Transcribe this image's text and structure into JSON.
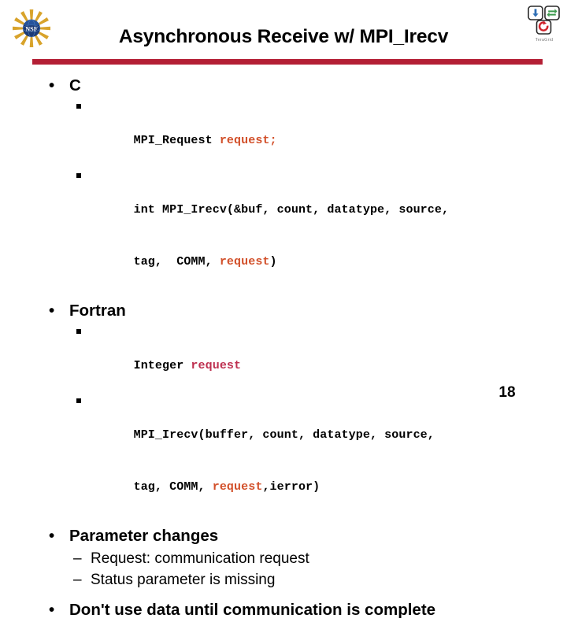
{
  "slide": {
    "title": "Asynchronous Receive w/ MPI_Irecv",
    "page_number": "18",
    "accent_color": "#B41F35",
    "highlight_orange": "#D2502A",
    "highlight_crimson": "#BE3050"
  },
  "logos": {
    "left": {
      "name": "nsf-logo",
      "text": "NSF"
    },
    "right": {
      "name": "teragrid-logo",
      "caption": "TeraGrid"
    }
  },
  "content": {
    "c_section": {
      "bullet_marker": "•",
      "label": "C",
      "lines": [
        {
          "marker": "▪",
          "parts": [
            {
              "text": "MPI_Request ",
              "style": "plain"
            },
            {
              "text": "request;",
              "style": "orange"
            }
          ]
        },
        {
          "marker": "▪",
          "parts": [
            {
              "text": "int MPI_Irecv(&buf, count, datatype, source,",
              "style": "plain"
            }
          ]
        },
        {
          "marker": "",
          "parts": [
            {
              "text": "tag,  COMM, ",
              "style": "plain"
            },
            {
              "text": "request",
              "style": "orange"
            },
            {
              "text": ")",
              "style": "plain"
            }
          ]
        }
      ]
    },
    "fortran_section": {
      "bullet_marker": "•",
      "label": "Fortran",
      "lines": [
        {
          "marker": "▪",
          "parts": [
            {
              "text": "Integer ",
              "style": "plain"
            },
            {
              "text": "request",
              "style": "crimson"
            }
          ]
        },
        {
          "marker": "▪",
          "parts": [
            {
              "text": "MPI_Irecv(buffer, count, datatype, source,",
              "style": "plain"
            }
          ]
        },
        {
          "marker": "",
          "parts": [
            {
              "text": "tag, COMM, ",
              "style": "plain"
            },
            {
              "text": "request",
              "style": "orange"
            },
            {
              "text": ",ierror)",
              "style": "plain"
            }
          ]
        }
      ]
    },
    "parameter_section": {
      "bullet_marker": "•",
      "label": "Parameter changes",
      "sub_marker": "–",
      "sub_items": [
        "Request: communication request",
        "Status parameter is missing"
      ]
    },
    "final_bullet": {
      "bullet_marker": "•",
      "label": "Don't use data until communication is complete"
    }
  }
}
